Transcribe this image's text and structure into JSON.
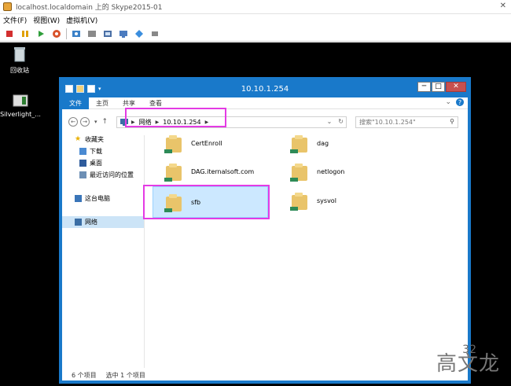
{
  "host": {
    "title": "localhost.localdomain 上的 Skype2015-01",
    "menu": [
      "文件(F)",
      "视图(W)",
      "虚拟机(V)"
    ]
  },
  "desktop": {
    "recycle_bin": "回收站",
    "silverlight": "Silverlight_..."
  },
  "explorer": {
    "title": "10.10.1.254",
    "tabs": [
      "文件",
      "主页",
      "共享",
      "查看"
    ],
    "address": [
      "网络",
      "10.10.1.254"
    ],
    "search_placeholder": "搜索\"10.10.1.254\"",
    "nav": [
      "收藏夹",
      "下载",
      "桌面",
      "最近访问的位置",
      "这台电脑",
      "网络"
    ],
    "files": [
      "CertEnroll",
      "dag",
      "DAG.iternalsoft.com",
      "netlogon",
      "sfb",
      "sysvol"
    ],
    "status_count": "6 个项目",
    "status_selected": "选中 1 个项目"
  },
  "watermark": "高文龙",
  "watermark_num": "32",
  "colors": {
    "accent": "#1979ca",
    "highlight": "#e43be4",
    "folder": "#e9c46a"
  }
}
